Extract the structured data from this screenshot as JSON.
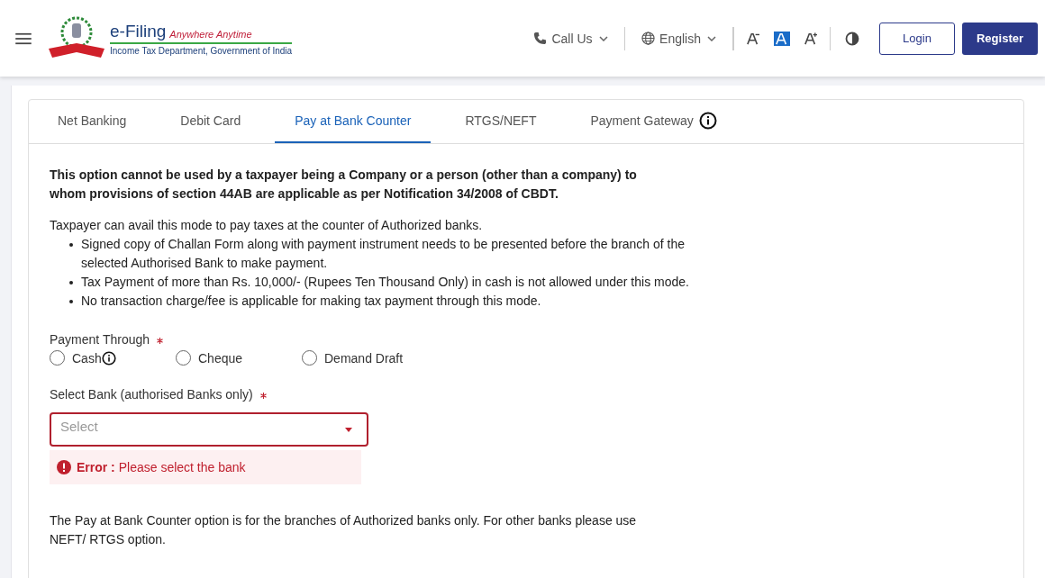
{
  "header": {
    "brand": "e-Filing",
    "tagline": "Anywhere Anytime",
    "subtitle": "Income Tax Department, Government of India",
    "call_us": "Call Us",
    "language": "English",
    "font_sizes": [
      {
        "kind": "decrease",
        "selected": false
      },
      {
        "kind": "normal",
        "selected": true
      },
      {
        "kind": "increase",
        "selected": false
      }
    ],
    "login": "Login",
    "register": "Register"
  },
  "tabs": [
    {
      "label": "Net Banking",
      "selected": false,
      "info": false
    },
    {
      "label": "Debit Card",
      "selected": false,
      "info": false
    },
    {
      "label": "Pay at Bank Counter",
      "selected": true,
      "info": false
    },
    {
      "label": "RTGS/NEFT",
      "selected": false,
      "info": false
    },
    {
      "label": "Payment Gateway",
      "selected": false,
      "info": true
    }
  ],
  "notice": "This option cannot be used by a taxpayer being a Company or a person (other than a company) to whom provisions of section 44AB are applicable as per Notification 34/2008 of CBDT.",
  "intro": "Taxpayer can avail this mode to pay taxes at the counter of Authorized banks.",
  "bullets": [
    "Signed copy of Challan Form along with payment instrument needs to be presented before the branch of the selected Authorised Bank to make payment.",
    "Tax Payment of more than Rs. 10,000/- (Rupees Ten Thousand Only) in cash is not allowed under this mode.",
    "No transaction charge/fee is applicable for making tax payment through this mode."
  ],
  "payment_through": {
    "label": "Payment Through",
    "required": true,
    "options": [
      {
        "label": "Cash",
        "selected": false,
        "info": true
      },
      {
        "label": "Cheque",
        "selected": false,
        "info": false
      },
      {
        "label": "Demand Draft",
        "selected": false,
        "info": false
      }
    ]
  },
  "bank_select": {
    "label": "Select Bank (authorised Banks only)",
    "required": true,
    "placeholder": "Select",
    "error_label": "Error :",
    "error": "Please select the bank"
  },
  "footer_note": "The Pay at Bank Counter option is for the branches of Authorized banks only. For other banks please use NEFT/ RTGS option."
}
